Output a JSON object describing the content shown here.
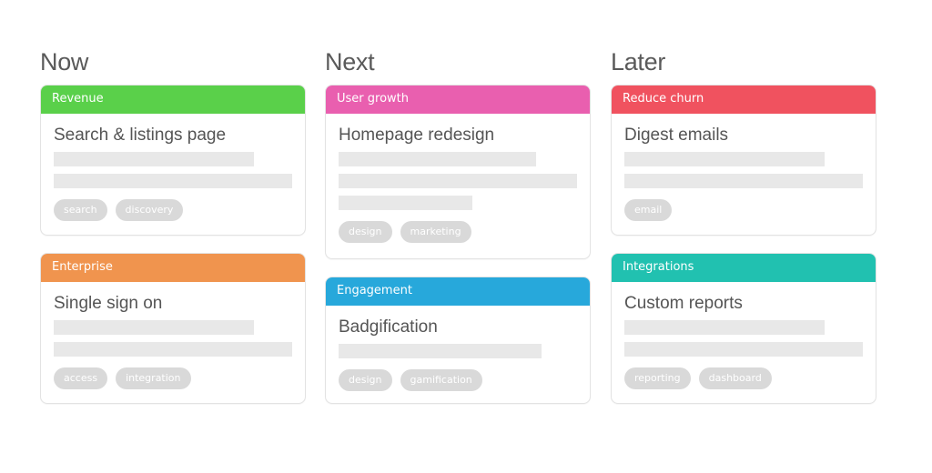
{
  "columns": [
    {
      "title": "Now",
      "cards": [
        {
          "category": "Revenue",
          "color": "#5ad04a",
          "title": "Search & listings page",
          "lines": [
            0.84,
            1.0
          ],
          "tags": [
            "search",
            "discovery"
          ]
        },
        {
          "category": "Enterprise",
          "color": "#f0944e",
          "title": "Single sign on",
          "lines": [
            0.84,
            1.0
          ],
          "tags": [
            "access",
            "integration"
          ]
        }
      ]
    },
    {
      "title": "Next",
      "cards": [
        {
          "category": "User growth",
          "color": "#e95faf",
          "title": "Homepage redesign",
          "lines": [
            0.83,
            1.0,
            0.56
          ],
          "tags": [
            "design",
            "marketing"
          ]
        },
        {
          "category": "Engagement",
          "color": "#27a8db",
          "title": "Badgification",
          "lines": [
            0.85
          ],
          "tags": [
            "design",
            "gamification"
          ]
        }
      ]
    },
    {
      "title": "Later",
      "cards": [
        {
          "category": "Reduce churn",
          "color": "#f0525f",
          "title": "Digest emails",
          "lines": [
            0.84,
            1.0
          ],
          "tags": [
            "email"
          ]
        },
        {
          "category": "Integrations",
          "color": "#21c1b0",
          "title": "Custom reports",
          "lines": [
            0.84,
            1.0
          ],
          "tags": [
            "reporting",
            "dashboard"
          ]
        }
      ]
    }
  ]
}
